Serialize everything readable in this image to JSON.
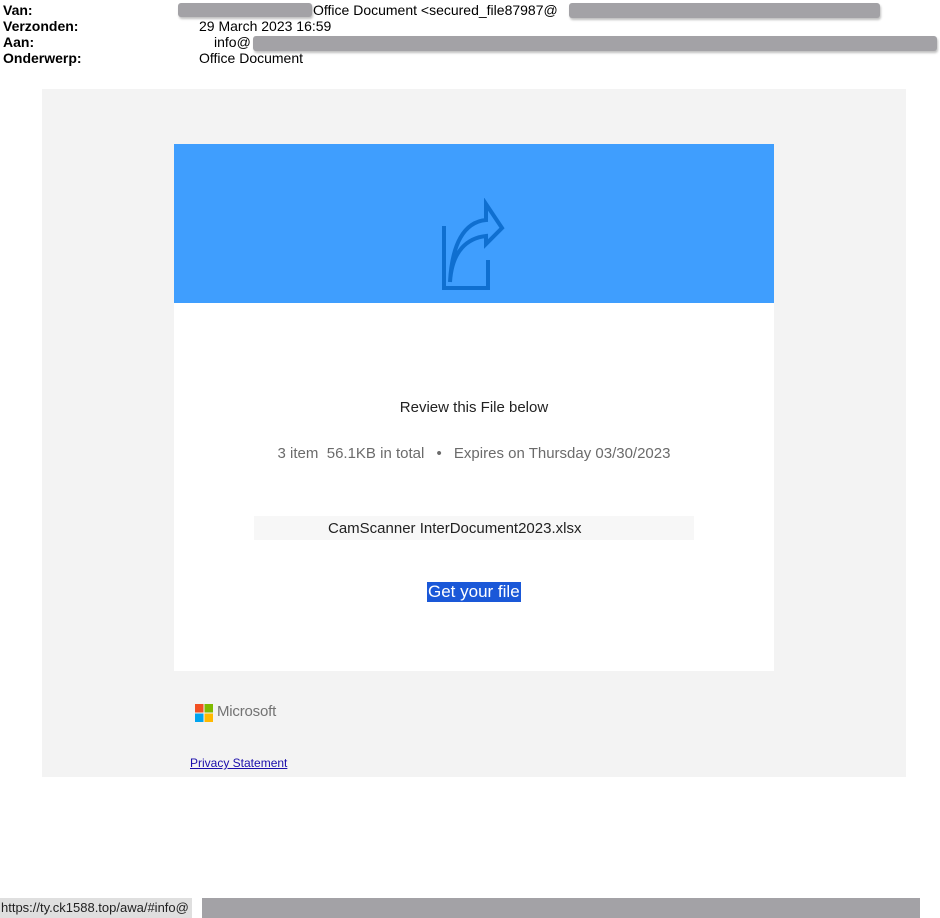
{
  "header": {
    "from_label": "Van:",
    "from_value": "Office Document <secured_file87987@",
    "sent_label": "Verzonden:",
    "sent_value": "29 March 2023 16:59",
    "to_label": "Aan:",
    "to_value": "info@",
    "subject_label": "Onderwerp:",
    "subject_value": "Office Document"
  },
  "email": {
    "review_text": "Review this File below",
    "item_count": "3 item",
    "total_size": "56.1KB in total",
    "separator": "•",
    "expires": "Expires on Thursday 03/30/2023",
    "file_name": "CamScanner InterDocument2023.xlsx",
    "cta_label": "Get your file",
    "brand_name": "Microsoft",
    "privacy_label": "Privacy Statement",
    "banner_icon": "share-file-icon"
  },
  "status_bar": {
    "url": "https://ty.ck1588.top/awa/#info@"
  },
  "colors": {
    "banner": "#3f9efe",
    "icon": "#0f6fd0",
    "cta_bg": "#1a58d8",
    "background": "#f3f3f3",
    "redaction": "#a3a2a6"
  }
}
